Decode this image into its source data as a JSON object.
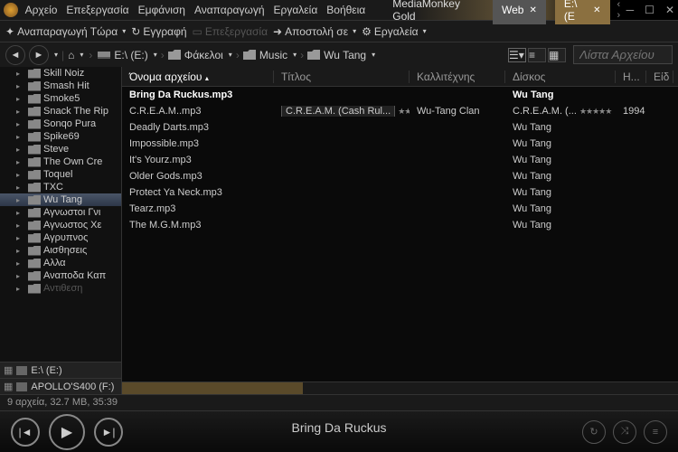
{
  "menu": [
    "Αρχείο",
    "Επεξεργασία",
    "Εμφάνιση",
    "Αναπαραγωγή",
    "Εργαλεία",
    "Βοήθεια"
  ],
  "app_title": "MediaMonkey Gold",
  "tabs": [
    {
      "label": "Web",
      "active": false
    },
    {
      "label": "E:\\ (E",
      "active": true
    }
  ],
  "titlebar_nav": "‹ ›",
  "toolbar1": {
    "play_now": "Αναπαραγωγή Τώρα",
    "record": "Εγγραφή",
    "edit": "Επεξεργασία",
    "send_to": "Αποστολή σε",
    "tools": "Εργαλεία"
  },
  "breadcrumb": [
    "E:\\ (E:)",
    "Φάκελοι",
    "Music",
    "Wu Tang"
  ],
  "search_placeholder": "Λίστα Αρχείου",
  "columns": {
    "filename": "Όνομα αρχείου",
    "title": "Τίτλος",
    "artist": "Καλλιτέχνης",
    "album": "Δίσκος",
    "year_short": "Η...",
    "kind": "Είδ"
  },
  "tree": [
    "Skill Noiz",
    "Smash Hit",
    "Smoke5",
    "Snack The Rip",
    "Sonqo Pura",
    "Spike69",
    "Steve",
    "The Own Cre",
    "Toquel",
    "TXC",
    "Wu Tang",
    "Αγνωστοι Γνι",
    "Αγνωστος Χε",
    "Αγρυπνος",
    "Αισθησεις",
    "Αλλα",
    "Αναποδα Καπ",
    "Αντιθεση"
  ],
  "tree_selected": "Wu Tang",
  "drives": [
    "E:\\ (E:)",
    "APOLLO'S400 (F:)"
  ],
  "group_header": {
    "filename": "Bring Da Ruckus.mp3",
    "album": "Wu Tang"
  },
  "rows": [
    {
      "filename": "C.R.E.A.M..mp3",
      "title": "C.R.E.A.M. (Cash Rul...",
      "artist": "Wu-Tang Clan",
      "album": "C.R.E.A.M. (...",
      "year": "1994",
      "rated": true
    },
    {
      "filename": "Deadly Darts.mp3",
      "album": "Wu Tang"
    },
    {
      "filename": "Impossible.mp3",
      "album": "Wu Tang"
    },
    {
      "filename": "It's Yourz.mp3",
      "album": "Wu Tang"
    },
    {
      "filename": "Older Gods.mp3",
      "album": "Wu Tang"
    },
    {
      "filename": "Protect Ya Neck.mp3",
      "album": "Wu Tang"
    },
    {
      "filename": "Tearz.mp3",
      "album": "Wu Tang"
    },
    {
      "filename": "The M.G.M.mp3",
      "album": "Wu Tang"
    }
  ],
  "status": "9 αρχεία, 32.7 MB, 35:39",
  "now_playing": "Bring Da Ruckus",
  "col_widths": {
    "filename": 168,
    "title": 150,
    "artist": 106,
    "album": 122,
    "year": 34,
    "kind": 30
  }
}
